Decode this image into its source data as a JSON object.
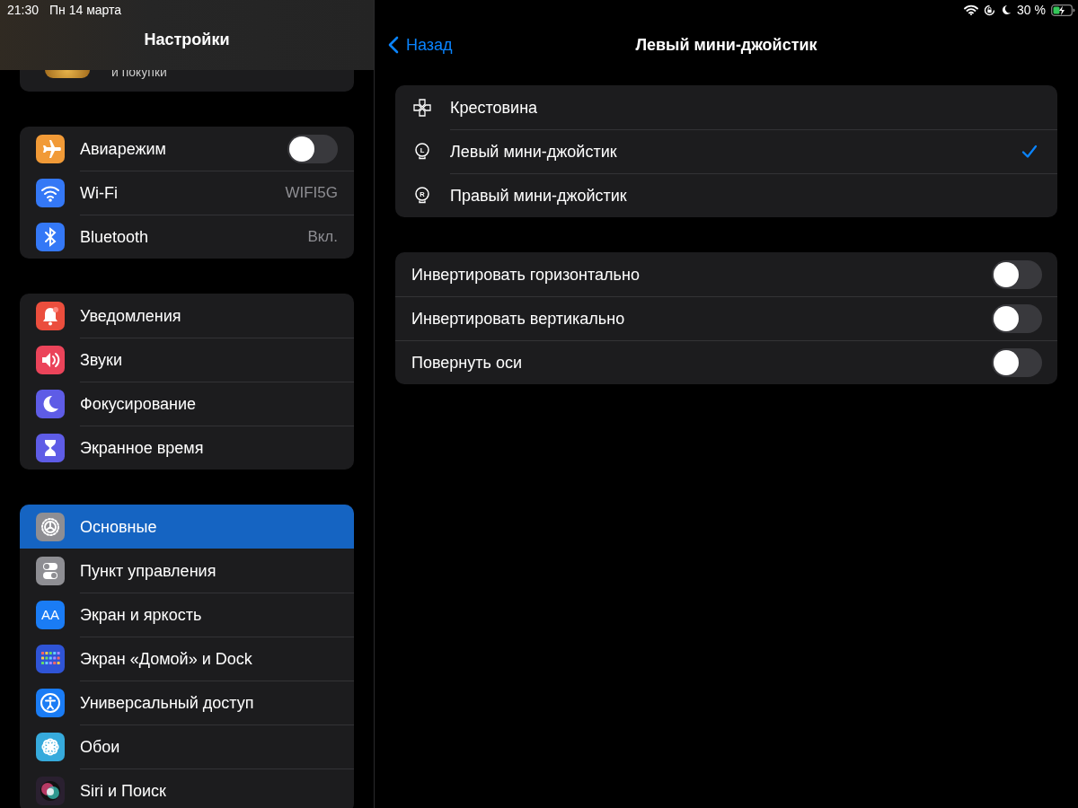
{
  "status_bar": {
    "time": "21:30",
    "date": "Пн 14 марта",
    "battery": "30 %"
  },
  "sidebar": {
    "title": "Настройки",
    "account": {
      "subtitle": "и покупки"
    },
    "groups": [
      {
        "items": [
          {
            "label": "Авиарежим",
            "color": "#f19a37",
            "kind": "toggle",
            "on": false,
            "selected": false
          },
          {
            "label": "Wi-Fi",
            "color": "#3478f6",
            "kind": "value",
            "value": "WIFI5G",
            "selected": false
          },
          {
            "label": "Bluetooth",
            "color": "#3478f6",
            "kind": "value",
            "value": "Вкл.",
            "selected": false
          }
        ]
      },
      {
        "items": [
          {
            "label": "Уведомления",
            "color": "#eb4e3d",
            "kind": "link",
            "selected": false
          },
          {
            "label": "Звуки",
            "color": "#eb445a",
            "kind": "link",
            "selected": false
          },
          {
            "label": "Фокусирование",
            "color": "#5e5ce6",
            "kind": "link",
            "selected": false
          },
          {
            "label": "Экранное время",
            "color": "#5e5ce6",
            "kind": "link",
            "selected": false
          }
        ]
      },
      {
        "items": [
          {
            "label": "Основные",
            "color": "#8e8e93",
            "kind": "link",
            "selected": true
          },
          {
            "label": "Пункт управления",
            "color": "#8e8e93",
            "kind": "link",
            "selected": false
          },
          {
            "label": "Экран и яркость",
            "color": "#1a7cf5",
            "kind": "link",
            "icon_label": "AA",
            "selected": false
          },
          {
            "label": "Экран «Домой» и Dock",
            "color": "#2f54d6",
            "kind": "link",
            "selected": false
          },
          {
            "label": "Универсальный доступ",
            "color": "#1a7cf5",
            "kind": "link",
            "selected": false
          },
          {
            "label": "Обои",
            "color": "#36aadc",
            "kind": "link",
            "selected": false
          },
          {
            "label": "Siri и Поиск",
            "color": "#2a2030",
            "kind": "link",
            "selected": false
          }
        ]
      }
    ]
  },
  "detail": {
    "back": "Назад",
    "title": "Левый мини-джойстик",
    "options": [
      {
        "label": "Крестовина",
        "selected": false
      },
      {
        "label": "Левый мини-джойстик",
        "icon_letter": "L",
        "selected": true
      },
      {
        "label": "Правый мини-джойстик",
        "icon_letter": "R",
        "selected": false
      }
    ],
    "toggles": [
      {
        "label": "Инвертировать горизонтально",
        "on": false
      },
      {
        "label": "Инвертировать вертикально",
        "on": false
      },
      {
        "label": "Повернуть оси",
        "on": false
      }
    ]
  }
}
